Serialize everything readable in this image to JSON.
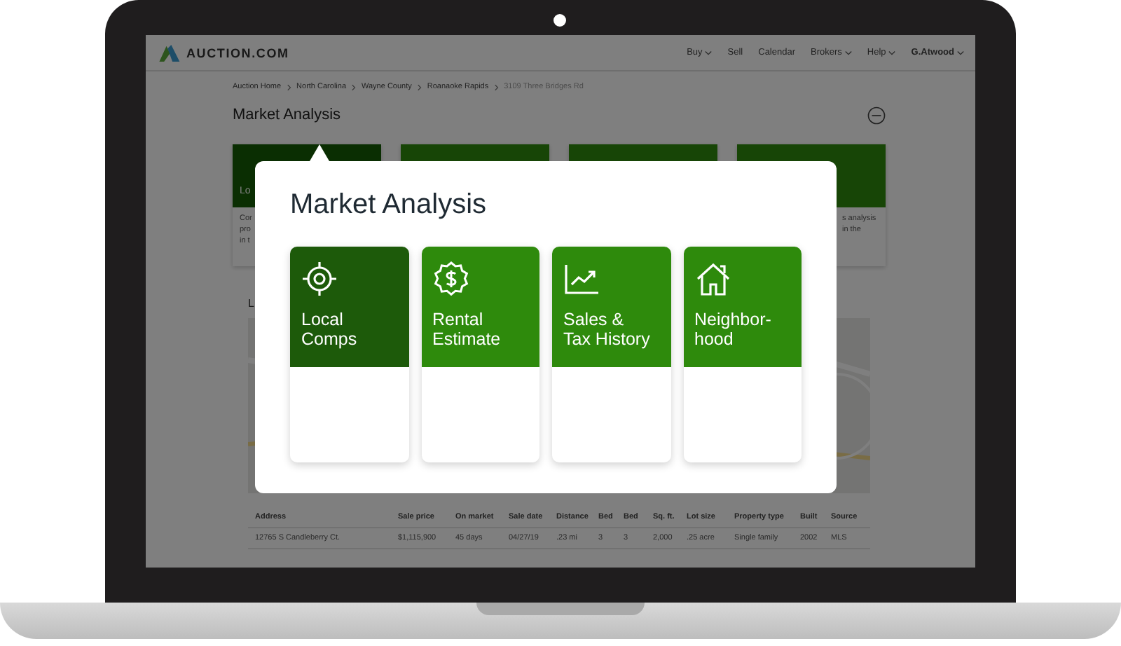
{
  "nav": {
    "logo": "AUCTION.COM",
    "items": [
      {
        "label": "Buy",
        "dropdown": true
      },
      {
        "label": "Sell",
        "dropdown": false
      },
      {
        "label": "Calendar",
        "dropdown": false
      },
      {
        "label": "Brokers",
        "dropdown": true
      },
      {
        "label": "Help",
        "dropdown": true
      },
      {
        "label": "G.Atwood",
        "dropdown": true
      }
    ]
  },
  "breadcrumb": [
    {
      "label": "Auction Home",
      "current": false
    },
    {
      "label": "North Carolina",
      "current": false
    },
    {
      "label": "Wayne County",
      "current": false
    },
    {
      "label": "Roanaoke Rapids",
      "current": false
    },
    {
      "label": "3109 Three Bridges Rd",
      "current": true
    }
  ],
  "page_title": "Market Analysis",
  "background_cards": [
    {
      "label": "Lo",
      "description": [
        "Cor",
        "pro",
        "in t"
      ],
      "selected": true
    },
    {
      "selected": false
    },
    {
      "selected": false
    },
    {
      "description": [
        "s analysis",
        "in the"
      ],
      "selected": false
    }
  ],
  "section_heading": "L",
  "table": {
    "columns": [
      "Address",
      "Sale price",
      "On market",
      "Sale date",
      "Distance",
      "Bed",
      "Bed",
      "Sq. ft.",
      "Lot size",
      "Property type",
      "Built",
      "Source"
    ],
    "rows": [
      [
        "12765 S Candleberry Ct.",
        "$1,115,900",
        "45 days",
        "04/27/19",
        ".23 mi",
        "3",
        "3",
        "2,000",
        ".25 acre",
        "Single family",
        "2002",
        "MLS"
      ]
    ]
  },
  "modal": {
    "title": "Market Analysis",
    "tiles": [
      {
        "kind": "target",
        "label": [
          "Local",
          "Comps"
        ],
        "selected": true
      },
      {
        "kind": "dollar",
        "label": [
          "Rental",
          "Estimate"
        ],
        "selected": false
      },
      {
        "kind": "chart",
        "label": [
          "Sales &",
          "Tax History"
        ],
        "selected": false
      },
      {
        "kind": "house",
        "label": [
          "Neighbor-",
          "hood"
        ],
        "selected": false
      }
    ]
  }
}
